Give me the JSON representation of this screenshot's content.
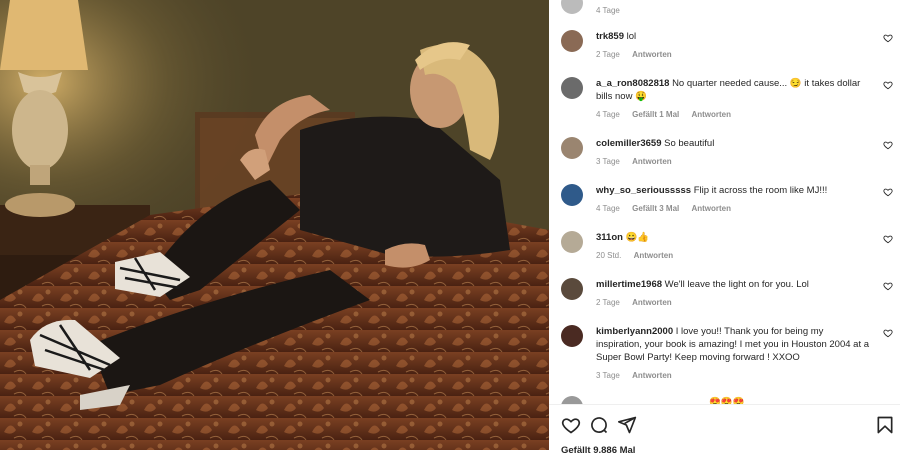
{
  "top_partial": {
    "time": "4 Tage"
  },
  "comments": [
    {
      "user": "trk859",
      "text": "lol",
      "time": "2 Tage",
      "likes": "",
      "reply": "Antworten",
      "avatar_color": "#8a6a55"
    },
    {
      "user": "a_a_ron8082818",
      "text": "No quarter needed cause... 😏 it takes dollar bills now 🤑",
      "time": "4 Tage",
      "likes": "Gefällt 1 Mal",
      "reply": "Antworten",
      "avatar_color": "#6b6b6b"
    },
    {
      "user": "colemiller3659",
      "text": "So beautiful",
      "time": "3 Tage",
      "likes": "",
      "reply": "Antworten",
      "avatar_color": "#9a8570"
    },
    {
      "user": "why_so_seriousssss",
      "text": "Flip it across the room like MJ!!!",
      "time": "4 Tage",
      "likes": "Gefällt 3 Mal",
      "reply": "Antworten",
      "avatar_color": "#2f5a8a"
    },
    {
      "user": "311on",
      "text": "😀👍",
      "time": "20 Std.",
      "likes": "",
      "reply": "Antworten",
      "avatar_color": "#b5aa96"
    },
    {
      "user": "millertime1968",
      "text": "We'll leave the light on for you. Lol",
      "time": "2 Tage",
      "likes": "",
      "reply": "Antworten",
      "avatar_color": "#5a4a3c"
    },
    {
      "user": "kimberlyann2000",
      "text": "I love you!! Thank you for being my inspiration, your book is amazing! I met you in Houston 2004 at a Super Bowl Party! Keep moving forward ! XXOO",
      "time": "3 Tage",
      "likes": "",
      "reply": "Antworten",
      "avatar_color": "#4a2a22"
    }
  ],
  "bottom_partial": {
    "emojis": "😍😍😍"
  },
  "actions": {
    "like": "heart-icon",
    "comment": "comment-icon",
    "share": "share-icon",
    "save": "bookmark-icon"
  },
  "likes_summary": "Gefällt 9.886 Mal"
}
